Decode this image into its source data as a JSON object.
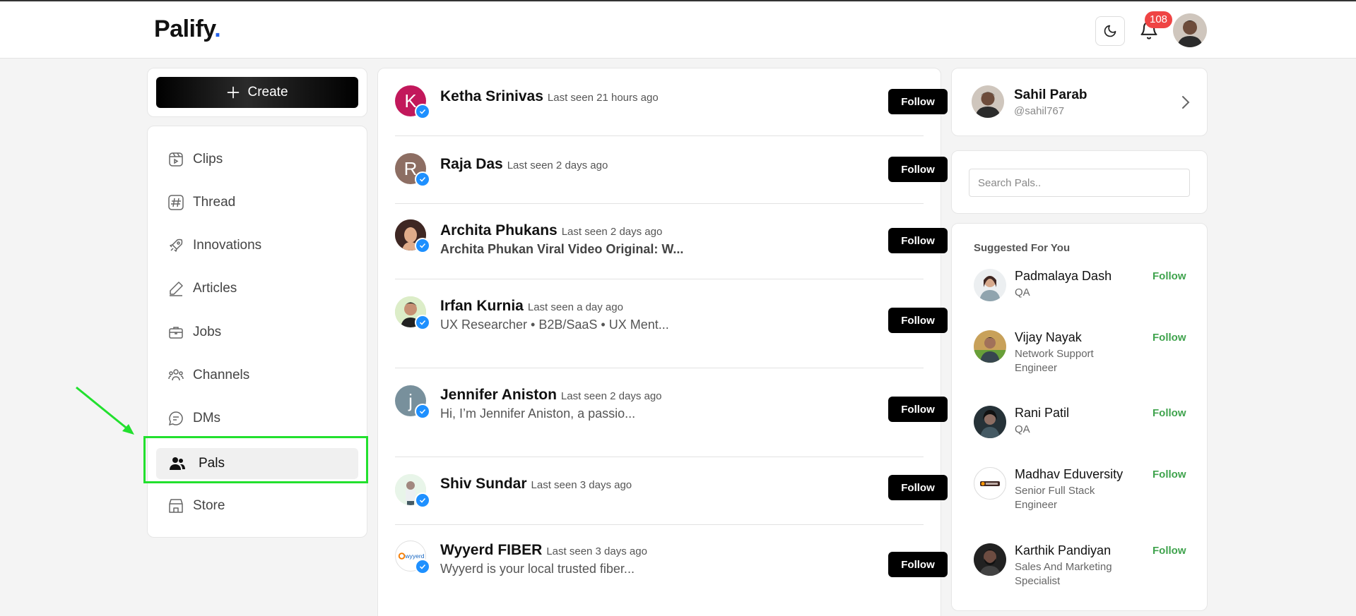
{
  "header": {
    "logo_text": "Palify",
    "logo_dot": ".",
    "notification_count": "108",
    "brand_color": "#2563eb"
  },
  "sidebar": {
    "create_label": "Create",
    "items": [
      {
        "label": "Clips",
        "icon": "clips-icon"
      },
      {
        "label": "Thread",
        "icon": "hashtag-icon"
      },
      {
        "label": "Innovations",
        "icon": "rocket-icon"
      },
      {
        "label": "Articles",
        "icon": "pencil-icon"
      },
      {
        "label": "Jobs",
        "icon": "briefcase-icon"
      },
      {
        "label": "Channels",
        "icon": "group-icon"
      },
      {
        "label": "DMs",
        "icon": "chat-icon"
      },
      {
        "label": "Pals",
        "icon": "users-icon",
        "active": true
      },
      {
        "label": "Store",
        "icon": "store-icon"
      }
    ]
  },
  "feed": {
    "follow_label": "Follow",
    "rows": [
      {
        "name": "Ketha Srinivas",
        "last_seen": "Last seen 21 hours ago",
        "bio": "",
        "initial": "K",
        "avatar_color": "#c2185b"
      },
      {
        "name": "Raja Das",
        "last_seen": "Last seen 2 days ago",
        "bio": "",
        "initial": "R",
        "avatar_color": "#8d6e63"
      },
      {
        "name": "Archita Phukans",
        "last_seen": "Last seen 2 days ago",
        "bio": "Archita Phukan Viral Video Original: W...",
        "initial": "",
        "avatar_color": "#6d4c41"
      },
      {
        "name": "Irfan Kurnia",
        "last_seen": "Last seen a day ago",
        "bio": "UX Researcher • B2B/SaaS • UX Ment...",
        "initial": "",
        "avatar_color": "#9ccc65"
      },
      {
        "name": "Jennifer Aniston",
        "last_seen": "Last seen 2 days ago",
        "bio": "Hi, I’m Jennifer Aniston, a passio...",
        "initial": "j",
        "avatar_color": "#78909c"
      },
      {
        "name": "Shiv Sundar",
        "last_seen": "Last seen 3 days ago",
        "bio": "",
        "initial": "",
        "avatar_color": "#8bc34a"
      },
      {
        "name": "Wyyerd FIBER",
        "last_seen": "Last seen 3 days ago",
        "bio": "Wyyerd is your local trusted fiber...",
        "initial": "",
        "avatar_color": "#ffffff",
        "logo_text": "wyyerd"
      }
    ]
  },
  "profile": {
    "name": "Sahil Parab",
    "handle": "@sahil767"
  },
  "search": {
    "placeholder": "Search Pals.."
  },
  "suggested": {
    "title": "Suggested For You",
    "follow_label": "Follow",
    "items": [
      {
        "name": "Padmalaya Dash",
        "role": "QA"
      },
      {
        "name": "Vijay Nayak",
        "role": "Network Support Engineer"
      },
      {
        "name": "Rani Patil",
        "role": "QA"
      },
      {
        "name": "Madhav Eduversity",
        "role": "Senior Full Stack Engineer"
      },
      {
        "name": "Karthik Pandiyan",
        "role": "Sales And Marketing Specialist"
      }
    ]
  },
  "colors": {
    "follow_green": "#3fa34d",
    "badge_red": "#ef4444",
    "verified_blue": "#1e90ff",
    "highlight_green": "#22e02e"
  }
}
